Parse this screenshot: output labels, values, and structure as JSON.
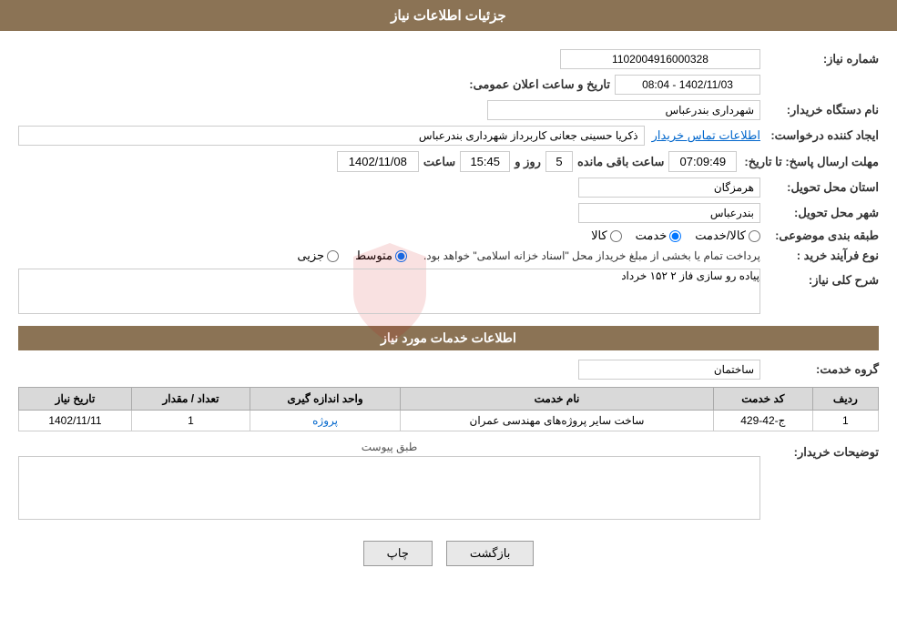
{
  "header": {
    "title": "جزئیات اطلاعات نیاز"
  },
  "fields": {
    "shomareNiaz_label": "شماره نیاز:",
    "shomareNiaz_value": "1102004916000328",
    "namDastgah_label": "نام دستگاه خریدار:",
    "namDastgah_value": "شهرداری بندرعباس",
    "ijadKonande_label": "ایجاد کننده درخواست:",
    "ijadKonande_value": "ذکریا حسینی جعانی کاربرداز شهرداری بندرعباس",
    "ettelaatTamas_link": "اطلاعات تماس خریدار",
    "mohlatErsalPasakh_label": "مهلت ارسال پاسخ: تا تاریخ:",
    "date1_value": "1402/11/08",
    "saat_label": "ساعت",
    "saat_value": "15:45",
    "roz_label": "روز و",
    "roz_value": "5",
    "saatBaghimande_label": "ساعت باقی مانده",
    "saatBaghimande_value": "07:09:49",
    "ostanMahale_label": "استان محل تحویل:",
    "ostanMahale_value": "هرمزگان",
    "shahrMahale_label": "شهر محل تحویل:",
    "shahrMahale_value": "بندرعباس",
    "tarikhoSaat_label": "تاریخ و ساعت اعلان عمومی:",
    "tarikhoSaat_value": "1402/11/03 - 08:04",
    "tabgheBandi_label": "طبقه بندی موضوعی:",
    "tabgheBandi_kala": "کالا",
    "tabgheBandi_khedmat": "خدمت",
    "tabgheBandi_kalaKhedmat": "کالا/خدمت",
    "noefarayand_label": "نوع فرآیند خرید :",
    "noefarayand_jezee": "جزیی",
    "noefarayand_motevaset": "متوسط",
    "noefarayand_text": "پرداخت تمام یا بخشی از مبلغ خریداز محل \"اسناد خزانه اسلامی\" خواهد بود.",
    "sharheKolli_label": "شرح کلی نیاز:",
    "sharheKolli_value": "پیاده رو سازی فاز ۲ ۱۵۲ خرداد",
    "ettelaatKhadamat_label": "اطلاعات خدمات مورد نیاز",
    "groupKhedmat_label": "گروه خدمت:",
    "groupKhedmat_value": "ساختمان",
    "table": {
      "headers": [
        "ردیف",
        "کد خدمت",
        "نام خدمت",
        "واحد اندازه گیری",
        "تعداد / مقدار",
        "تاریخ نیاز"
      ],
      "rows": [
        {
          "radif": "1",
          "kodKhedmat": "ج-42-429",
          "namKhedmat": "ساخت سایر پروژه‌های مهندسی عمران",
          "vahed": "پروژه",
          "tedad": "1",
          "tarikh": "1402/11/11"
        }
      ]
    },
    "tosihKhridar_label": "توضیحات خریدار:",
    "attachments_label": "طبق پیوست"
  },
  "buttons": {
    "print": "چاپ",
    "back": "بازگشت"
  }
}
